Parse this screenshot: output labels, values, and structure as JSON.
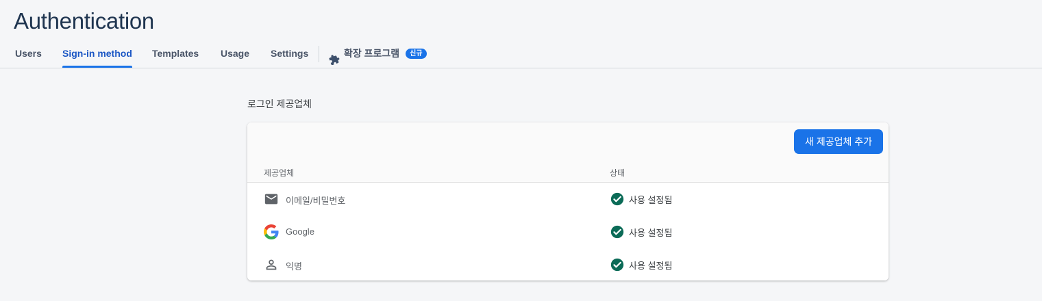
{
  "page": {
    "title": "Authentication"
  },
  "tabs": [
    {
      "label": "Users",
      "active": false
    },
    {
      "label": "Sign-in method",
      "active": true
    },
    {
      "label": "Templates",
      "active": false
    },
    {
      "label": "Usage",
      "active": false
    },
    {
      "label": "Settings",
      "active": false
    }
  ],
  "extensions_tab": {
    "label": "확장 프로그램",
    "badge": "신규",
    "icon": "puzzle-icon"
  },
  "section": {
    "title": "로그인 제공업체"
  },
  "providers_card": {
    "add_button_label": "새 제공업체 추가",
    "columns": {
      "provider": "제공업체",
      "status": "상태"
    },
    "rows": [
      {
        "icon": "email-icon",
        "name": "이메일/비밀번호",
        "status": "사용 설정됨",
        "status_icon": "check-circle-icon"
      },
      {
        "icon": "google-icon",
        "name": "Google",
        "status": "사용 설정됨",
        "status_icon": "check-circle-icon"
      },
      {
        "icon": "person-icon",
        "name": "익명",
        "status": "사용 설정됨",
        "status_icon": "check-circle-icon"
      }
    ]
  },
  "colors": {
    "accent": "#1a73e8",
    "status_enabled": "#0b6b57",
    "title": "#1f3550",
    "background": "#f5f6f8"
  }
}
